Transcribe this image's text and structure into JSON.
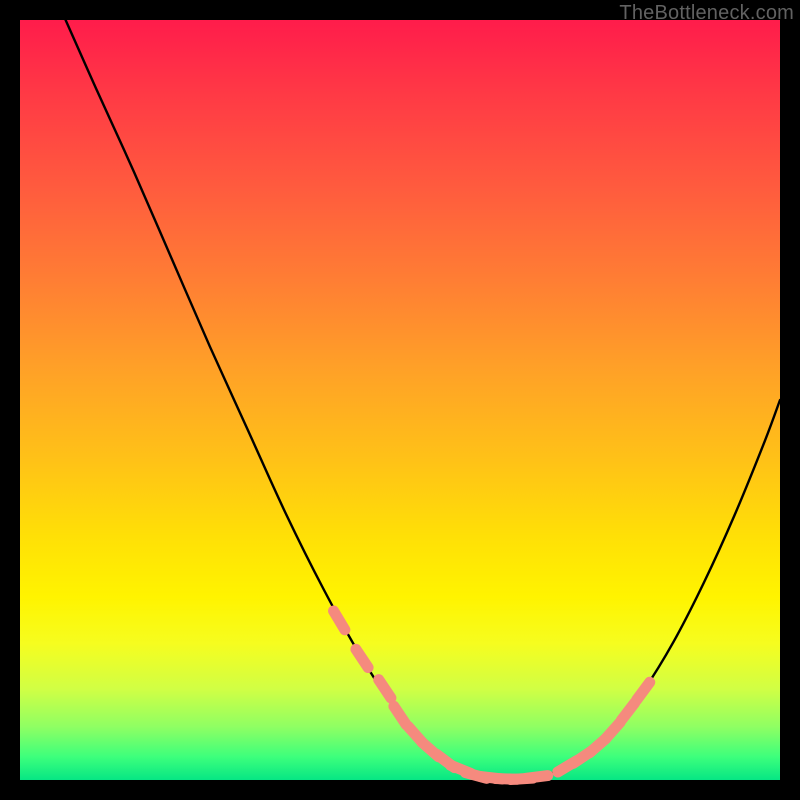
{
  "watermark": {
    "label": "TheBottleneck.com"
  },
  "colors": {
    "background": "#000000",
    "curve": "#000000",
    "marker": "#f58a7e",
    "gradient_top": "#ff1c4b",
    "gradient_bottom": "#06e684"
  },
  "chart_data": {
    "type": "line",
    "title": "",
    "xlabel": "",
    "ylabel": "",
    "xlim": [
      0,
      100
    ],
    "ylim": [
      0,
      100
    ],
    "grid": false,
    "series": [
      {
        "name": "bottleneck-curve",
        "x": [
          6,
          10,
          15,
          20,
          25,
          30,
          35,
          40,
          45,
          50,
          55,
          58,
          60,
          63,
          66,
          70,
          74,
          78,
          82,
          86,
          90,
          94,
          98,
          100
        ],
        "y": [
          100,
          91,
          80,
          68.5,
          57,
          46,
          35,
          25,
          16,
          8.5,
          3.3,
          1.4,
          0.6,
          0.15,
          0.15,
          0.9,
          3.0,
          6.5,
          11.7,
          18.2,
          26.0,
          34.8,
          44.6,
          50.0
        ]
      }
    ],
    "markers": [
      {
        "name": "left-transition",
        "points_x": [
          42,
          45,
          48,
          50,
          52,
          54,
          56
        ],
        "points_y": [
          21,
          16,
          12,
          8.5,
          6,
          4,
          2.5
        ]
      },
      {
        "name": "basin",
        "points_x": [
          58,
          60,
          62,
          64,
          66,
          68
        ],
        "points_y": [
          1.4,
          0.6,
          0.3,
          0.15,
          0.15,
          0.4
        ]
      },
      {
        "name": "right-transition",
        "points_x": [
          72,
          74,
          76,
          78,
          80,
          82
        ],
        "points_y": [
          1.8,
          3.0,
          4.5,
          6.5,
          9.0,
          11.7
        ]
      }
    ]
  }
}
